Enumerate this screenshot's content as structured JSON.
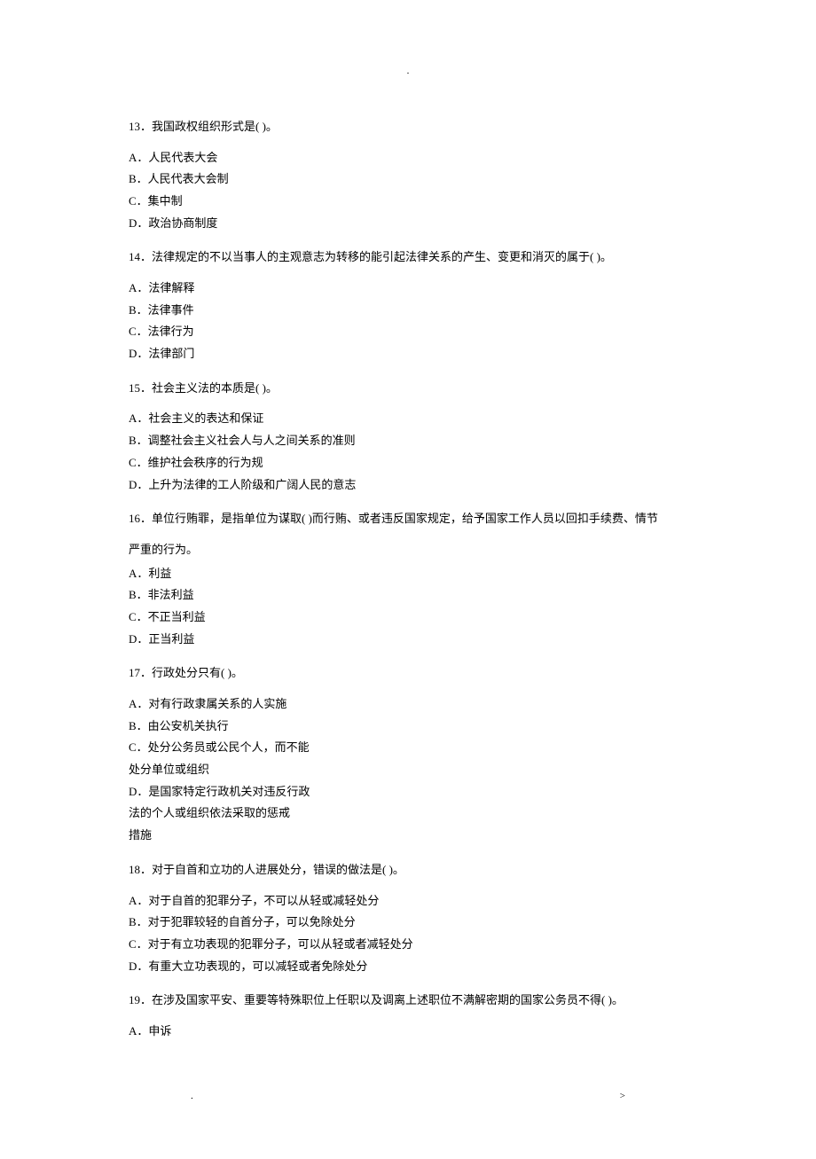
{
  "dot": ".",
  "q13": {
    "stem": "13．我国政权组织形式是( )。",
    "A": "A．人民代表大会",
    "B": "B．人民代表大会制",
    "C": "C．集中制",
    "D": "D．政治协商制度"
  },
  "q14": {
    "stem": "14．法律规定的不以当事人的主观意志为转移的能引起法律关系的产生、变更和消灭的属于( )。",
    "A": "A．法律解释",
    "B": "B．法律事件",
    "C": "C．法律行为",
    "D": "D．法律部门"
  },
  "q15": {
    "stem": "15．社会主义法的本质是( )。",
    "A": "A．社会主义的表达和保证",
    "B": "B．调整社会主义社会人与人之间关系的准则",
    "C": "C．维护社会秩序的行为规",
    "D": "D．上升为法律的工人阶级和广阔人民的意志"
  },
  "q16": {
    "stem": "16．单位行贿罪，是指单位为谋取( )而行贿、或者违反国家规定，给予国家工作人员以回扣手续费、情节",
    "cont": "严重的行为。",
    "A": "A．利益",
    "B": "B．非法利益",
    "C": "C．不正当利益",
    "D": "D．正当利益"
  },
  "q17": {
    "stem": "17．行政处分只有( )。",
    "A": "A．对有行政隶属关系的人实施",
    "B": "B．由公安机关执行",
    "C1": "C．处分公务员或公民个人，而不能",
    "C2": "处分单位或组织",
    "D1": "D．是国家特定行政机关对违反行政",
    "D2": "法的个人或组织依法采取的惩戒",
    "D3": "措施"
  },
  "q18": {
    "stem": "18．对于自首和立功的人进展处分，错误的做法是( )。",
    "A": "A．对于自首的犯罪分子，不可以从轻或减轻处分",
    "B": "B．对于犯罪较轻的自首分子，可以免除处分",
    "C": "C．对于有立功表现的犯罪分子，可以从轻或者减轻处分",
    "D": "D．有重大立功表现的，可以减轻或者免除处分"
  },
  "q19": {
    "stem": "19．在涉及国家平安、重要等特殊职位上任职以及调离上述职位不满解密期的国家公务员不得( )。",
    "A": "A．申诉"
  },
  "footer": {
    "left": ".",
    "right": ">"
  }
}
